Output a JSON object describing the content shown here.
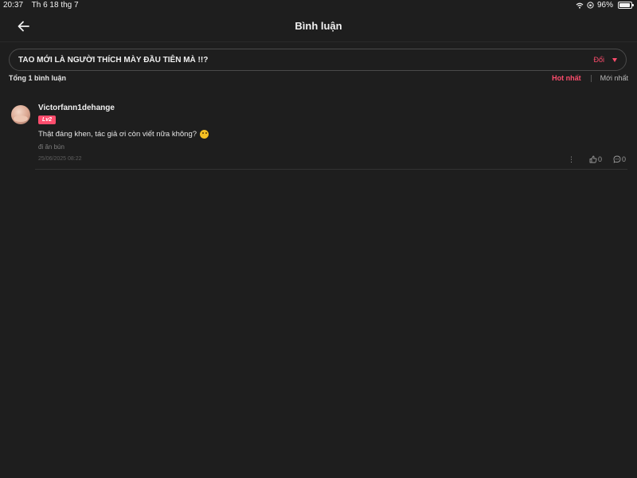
{
  "status_bar": {
    "time": "20:37",
    "date": "Th 6 18 thg 7",
    "battery": "96%",
    "battery_level": 0.96
  },
  "header": {
    "title": "Bình luận"
  },
  "chapter": {
    "title": "TAO MỚI LÀ NGƯỜI THÍCH MÀY ĐẦU TIÊN MÀ !!?",
    "change_label": "Đổi"
  },
  "sort": {
    "total": "Tổng 1 bình luận",
    "hot": "Hot nhất",
    "new": "Mới nhất"
  },
  "comments": [
    {
      "username": "Victorfann1dehange",
      "level": "Lv2",
      "text": "Thật đáng khen, tác giả ơi còn viết nữa không?",
      "chapter": "đi ăn bún",
      "timestamp": "25/06/2025 08:22",
      "likes": "0",
      "replies": "0"
    }
  ],
  "colors": {
    "accent": "#ff4d6d",
    "background": "#1e1e1e"
  }
}
